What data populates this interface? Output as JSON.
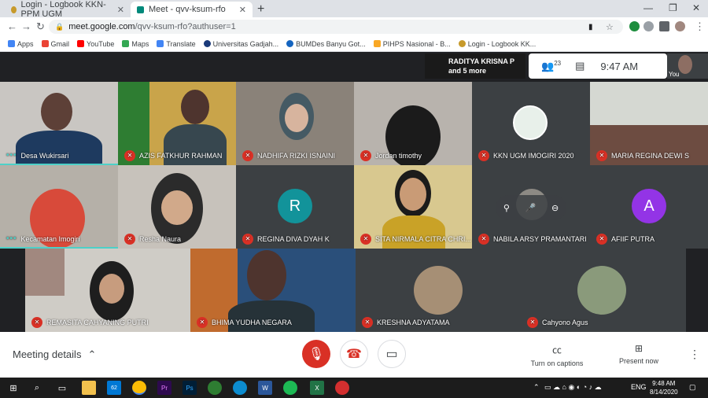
{
  "browser": {
    "tabs": [
      {
        "title": "Login - Logbook KKN-PPM UGM",
        "active": false
      },
      {
        "title": "Meet - qvv-ksum-rfo",
        "active": true
      }
    ],
    "url_host": "meet.google.com",
    "url_path": "/qvv-ksum-rfo?authuser=1",
    "bookmarks": [
      "Apps",
      "Gmail",
      "YouTube",
      "Maps",
      "Translate",
      "Universitas Gadjah...",
      "BUMDes Banyu Got...",
      "PIHPS Nasional - B...",
      "Login - Logbook KK..."
    ]
  },
  "meet": {
    "presenting": "RADITYA KRISNA P",
    "presenting_more": "and 5 more",
    "participant_count": "23",
    "time": "9:47 AM",
    "self_label": "You",
    "participants": [
      {
        "name": "Desa Wukirsari",
        "indicator": "active"
      },
      {
        "name": "AZIS FATKHUR RAHMAN",
        "indicator": "muted"
      },
      {
        "name": "NADHIFA RIZKI ISNAINI",
        "indicator": "muted"
      },
      {
        "name": "Jordan timothy",
        "indicator": "muted"
      },
      {
        "name": "KKN UGM IMOGIRI 2020",
        "indicator": "muted"
      },
      {
        "name": "MARIA REGINA DEWI S",
        "indicator": "muted"
      },
      {
        "name": "Kecamatan Imogiri",
        "indicator": "active"
      },
      {
        "name": "Resha Naura",
        "indicator": "muted"
      },
      {
        "name": "REGINA DIVA DYAH K",
        "indicator": "muted",
        "initial": "R"
      },
      {
        "name": "SITA NIRMALA CITRA CHRI...",
        "indicator": "muted"
      },
      {
        "name": "NABILA ARSY PRAMANTARI",
        "indicator": "muted"
      },
      {
        "name": "AFIIF PUTRA",
        "indicator": "muted",
        "initial": "A"
      },
      {
        "name": "REMASITA CAHYANING PUTRI",
        "indicator": "muted"
      },
      {
        "name": "BHIMA YUDHA NEGARA",
        "indicator": "muted"
      },
      {
        "name": "KRESHNA ADYATAMA",
        "indicator": "muted"
      },
      {
        "name": "Cahyono Agus",
        "indicator": "muted"
      }
    ]
  },
  "controls": {
    "meeting_details": "Meeting details",
    "captions": "Turn on captions",
    "present": "Present now"
  },
  "taskbar": {
    "badge": "62",
    "lang": "ENG",
    "time": "9:48 AM",
    "date": "8/14/2020"
  },
  "colors": {
    "meet_bg": "#202124",
    "red": "#d93025",
    "avatar_r": "#12939a",
    "avatar_a": "#9334e6",
    "speaking": "#4dd0c8"
  }
}
